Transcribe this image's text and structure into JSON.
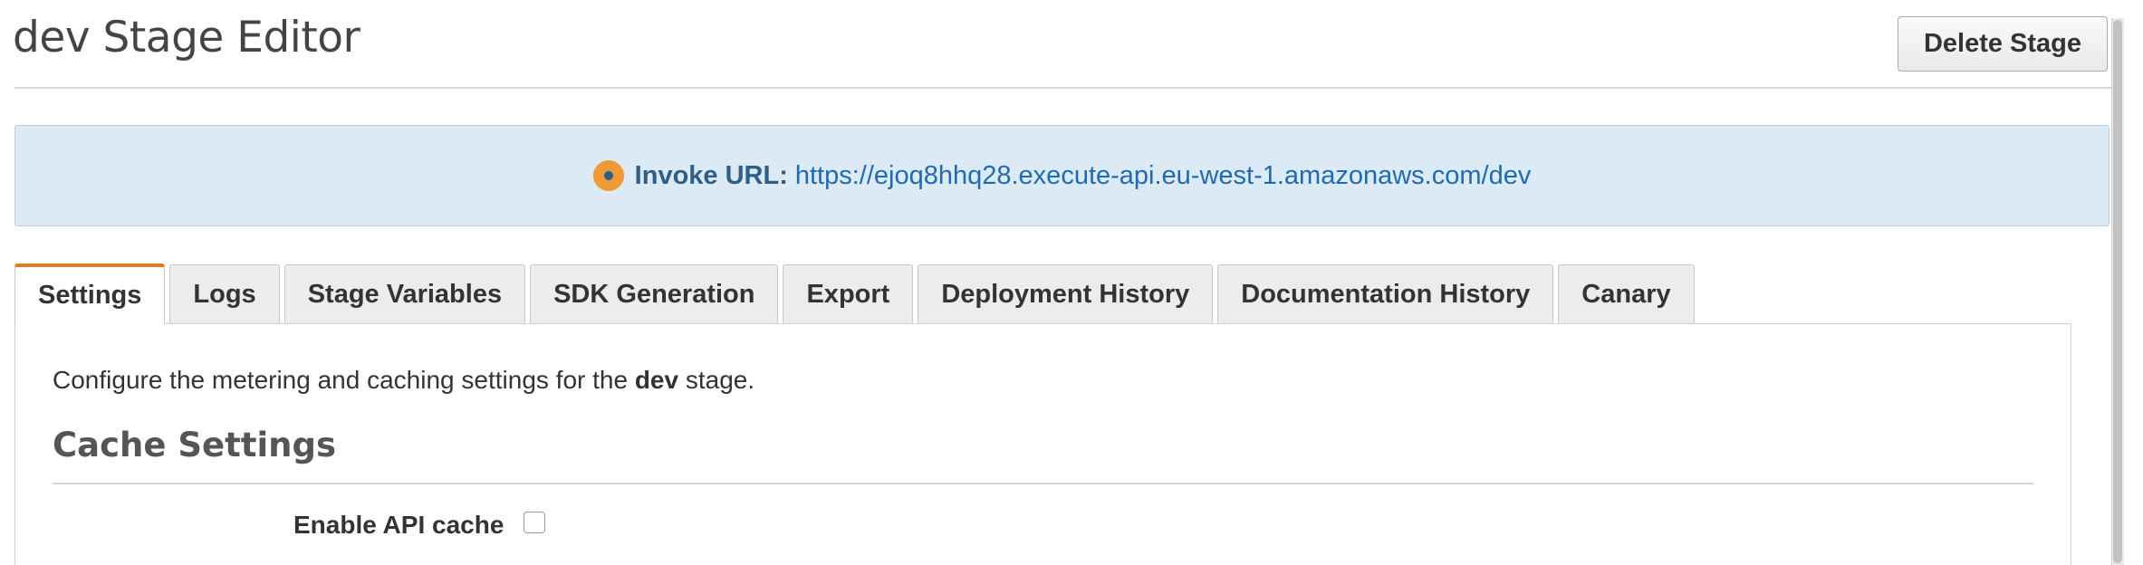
{
  "header": {
    "title": "dev Stage Editor",
    "delete_button": "Delete Stage"
  },
  "invoke": {
    "label": "Invoke URL:",
    "url": "https://ejoq8hhq28.execute-api.eu-west-1.amazonaws.com/dev",
    "icon": "info-circle-icon"
  },
  "tabs": [
    {
      "label": "Settings",
      "active": true
    },
    {
      "label": "Logs",
      "active": false
    },
    {
      "label": "Stage Variables",
      "active": false
    },
    {
      "label": "SDK Generation",
      "active": false
    },
    {
      "label": "Export",
      "active": false
    },
    {
      "label": "Deployment History",
      "active": false
    },
    {
      "label": "Documentation History",
      "active": false
    },
    {
      "label": "Canary",
      "active": false
    }
  ],
  "settings": {
    "description_prefix": "Configure the metering and caching settings for the ",
    "description_stage": "dev",
    "description_suffix": " stage.",
    "cache_section_title": "Cache Settings",
    "enable_cache_label": "Enable API cache",
    "enable_cache_checked": false
  },
  "colors": {
    "accent_tab": "#e07b1f",
    "info_bg": "#dbeaf5",
    "link": "#1f6ab0",
    "info_icon": "#ee9a35"
  }
}
